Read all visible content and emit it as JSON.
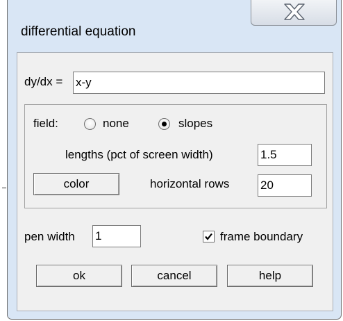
{
  "window": {
    "title": "differential equation"
  },
  "equation": {
    "label": "dy/dx =",
    "value": "x-y"
  },
  "field": {
    "label": "field:",
    "options": [
      {
        "label": "none",
        "selected": false
      },
      {
        "label": "slopes",
        "selected": true
      }
    ],
    "lengths_label": "lengths (pct of screen width)",
    "lengths_value": "1.5",
    "color_button": "color",
    "rows_label": "horizontal rows",
    "rows_value": "20"
  },
  "pen": {
    "label": "pen width",
    "value": "1"
  },
  "frame": {
    "label": "frame boundary",
    "checked": true
  },
  "buttons": {
    "ok": "ok",
    "cancel": "cancel",
    "help": "help"
  },
  "icons": {
    "close": "close-icon",
    "radio_selected": "radio-dot-icon",
    "checkbox": "checkmark-icon"
  }
}
